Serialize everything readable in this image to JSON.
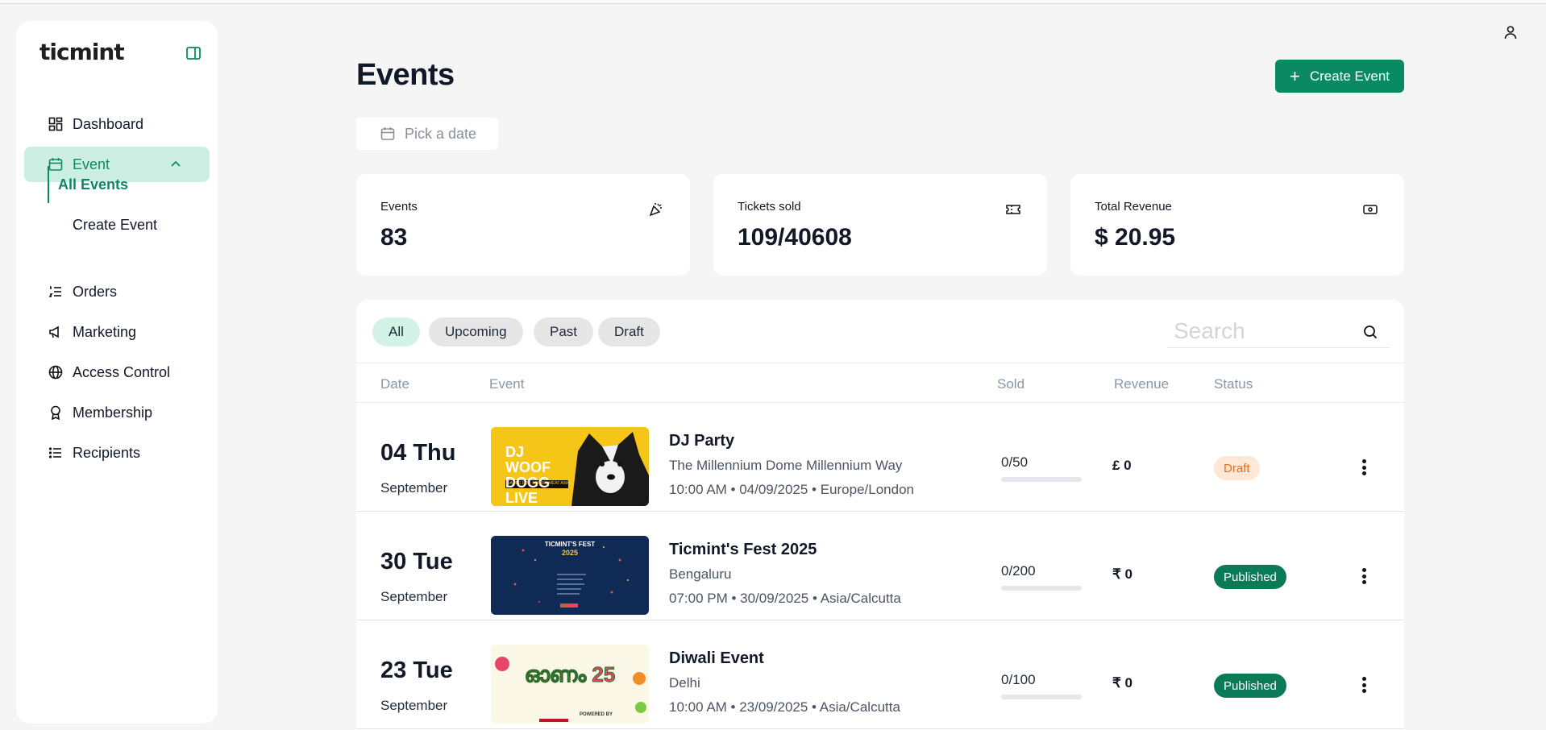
{
  "app": {
    "brand": "ticmint"
  },
  "sidebar": {
    "items": [
      {
        "label": "Dashboard",
        "icon": "dashboard-icon"
      },
      {
        "label": "Event",
        "icon": "calendar-icon"
      },
      {
        "label": "Orders",
        "icon": "list-ordered-icon"
      },
      {
        "label": "Marketing",
        "icon": "megaphone-icon"
      },
      {
        "label": "Access Control",
        "icon": "globe-lock-icon"
      },
      {
        "label": "Membership",
        "icon": "award-icon"
      },
      {
        "label": "Recipients",
        "icon": "list-icon"
      }
    ],
    "subitems": [
      {
        "label": "All Events"
      },
      {
        "label": "Create Event"
      }
    ]
  },
  "header": {
    "title": "Events",
    "create_label": "Create Event",
    "date_placeholder": "Pick a date"
  },
  "stats": [
    {
      "label": "Events",
      "value": "83",
      "icon": "party-popper-icon"
    },
    {
      "label": "Tickets sold",
      "value": "109/40608",
      "icon": "ticket-icon"
    },
    {
      "label": "Total Revenue",
      "value": "$ 20.95",
      "icon": "banknote-icon"
    }
  ],
  "filters": [
    "All",
    "Upcoming",
    "Past",
    "Draft"
  ],
  "search": {
    "placeholder": "Search"
  },
  "table": {
    "columns": [
      "Date",
      "Event",
      "Sold",
      "Revenue",
      "Status"
    ],
    "rows": [
      {
        "day": "04 Thu",
        "month": "September",
        "title": "DJ Party",
        "venue": "The Millennium Dome Millennium Way",
        "time": "10:00 AM • 04/09/2025 • Europe/London",
        "sold": "0/50",
        "sold_fraction": 0,
        "revenue": "£ 0",
        "status": "Draft",
        "thumb_text": "DJ WOOF DOGG LIVE",
        "thumb_sub": "DANCE FOR STREET MEAT AWAY"
      },
      {
        "day": "30 Tue",
        "month": "September",
        "title": "Ticmint's Fest 2025",
        "venue": "Bengaluru",
        "time": "07:00 PM • 30/09/2025 • Asia/Calcutta",
        "sold": "0/200",
        "sold_fraction": 0,
        "revenue": "₹ 0",
        "status": "Published",
        "thumb_text": "TICMINT'S FEST",
        "thumb_sub": "2025"
      },
      {
        "day": "23 Tue",
        "month": "September",
        "title": "Diwali Event",
        "venue": "Delhi",
        "time": "10:00 AM • 23/09/2025 • Asia/Calcutta",
        "sold": "0/100",
        "sold_fraction": 0,
        "revenue": "₹ 0",
        "status": "Published",
        "thumb_text": "ഓണം 25",
        "thumb_sub": "POWERED BY"
      }
    ]
  },
  "colors": {
    "accent": "#0a8a63",
    "accent_light": "#cdeee2",
    "draft_bg": "#fde7d6",
    "draft_fg": "#e0701d"
  }
}
